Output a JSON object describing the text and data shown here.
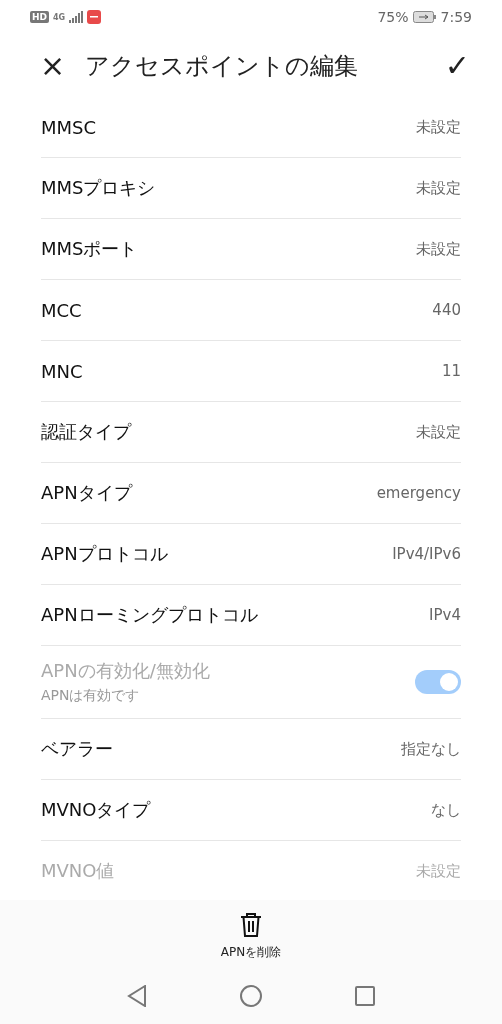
{
  "status_bar": {
    "badge": "HD",
    "network": "4G",
    "battery_percent": "75%",
    "time": "7:59"
  },
  "header": {
    "close_icon": "×",
    "title": "アクセスポイントの編集",
    "confirm_icon": "✓"
  },
  "rows": [
    {
      "kind": "value",
      "label": "MMSC",
      "value": "未設定",
      "disabled": false
    },
    {
      "kind": "value",
      "label": "MMSプロキシ",
      "value": "未設定",
      "disabled": false
    },
    {
      "kind": "value",
      "label": "MMSポート",
      "value": "未設定",
      "disabled": false
    },
    {
      "kind": "value",
      "label": "MCC",
      "value": "440",
      "disabled": false
    },
    {
      "kind": "value",
      "label": "MNC",
      "value": "11",
      "disabled": false
    },
    {
      "kind": "value",
      "label": "認証タイプ",
      "value": "未設定",
      "disabled": false
    },
    {
      "kind": "value",
      "label": "APNタイプ",
      "value": "emergency",
      "disabled": false
    },
    {
      "kind": "value",
      "label": "APNプロトコル",
      "value": "IPv4/IPv6",
      "disabled": false
    },
    {
      "kind": "value",
      "label": "APNローミングプロトコル",
      "value": "IPv4",
      "disabled": false
    },
    {
      "kind": "switch",
      "label": "APNの有効化/無効化",
      "summary": "APNは有効です",
      "on": true,
      "disabled": true
    },
    {
      "kind": "value",
      "label": "ベアラー",
      "value": "指定なし",
      "disabled": false
    },
    {
      "kind": "value",
      "label": "MVNOタイプ",
      "value": "なし",
      "disabled": false
    },
    {
      "kind": "value",
      "label": "MVNO値",
      "value": "未設定",
      "disabled": true
    }
  ],
  "bottom_action": {
    "label": "APNを削除"
  }
}
